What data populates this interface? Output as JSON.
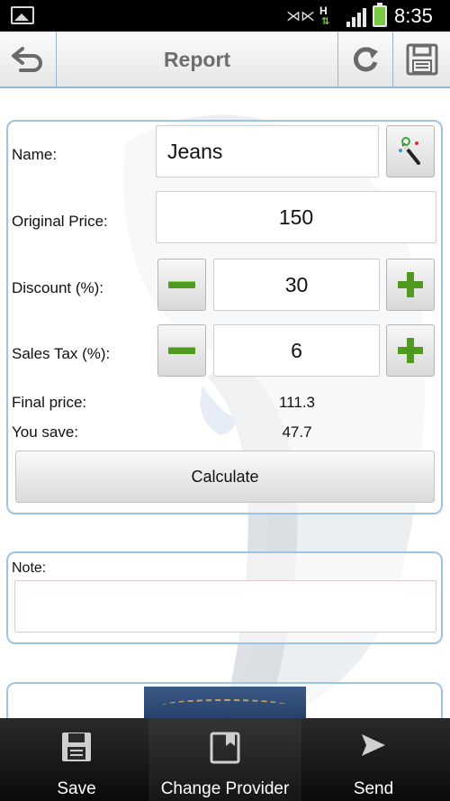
{
  "status_bar": {
    "time": "8:35",
    "icons": [
      "gallery-icon",
      "mute-icon",
      "network-h-icon",
      "signal-icon",
      "battery-icon"
    ]
  },
  "action_bar": {
    "title": "Report",
    "left_icon": "undo-arrow-icon",
    "right_icons": [
      "refresh-icon",
      "floppy-save-icon"
    ]
  },
  "form": {
    "name_label": "Name:",
    "name_value": "Jeans",
    "name_button_icon": "magic-wand-icon",
    "original_price_label": "Original Price:",
    "original_price_value": "150",
    "discount_label": "Discount (%):",
    "discount_value": "30",
    "sales_tax_label": "Sales Tax (%):",
    "sales_tax_value": "6",
    "final_price_label": "Final price:",
    "final_price_value": "111.3",
    "you_save_label": "You save:",
    "you_save_value": "47.7",
    "calculate_label": "Calculate"
  },
  "note": {
    "label": "Note:",
    "value": ""
  },
  "bottom_bar": {
    "items": [
      {
        "label": "Save",
        "icon": "floppy-icon"
      },
      {
        "label": "Change Provider",
        "icon": "bookmark-icon"
      },
      {
        "label": "Send",
        "icon": "send-icon"
      }
    ]
  },
  "colors": {
    "accent_border": "#9fc3e2",
    "action_bar_divider": "#8fb7d9",
    "stepper_green": "#4f9a1f",
    "status_bar_bg": "#000000"
  }
}
